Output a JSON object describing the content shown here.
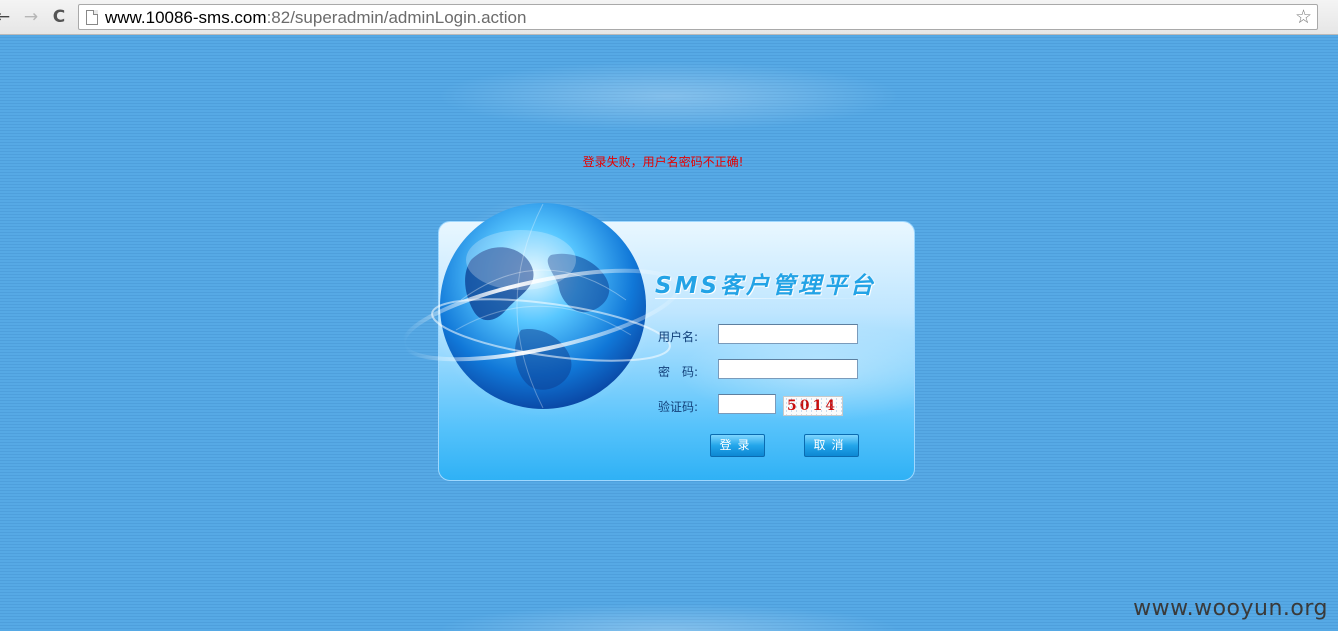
{
  "browser": {
    "url_host": "www.10086-sms.com",
    "url_path": ":82/superadmin/adminLogin.action",
    "back_glyph": "←",
    "forward_glyph": "→",
    "reload_glyph": "C",
    "star_glyph": "☆"
  },
  "page": {
    "error_message": "登录失败，用户名密码不正确!"
  },
  "login": {
    "title": "SMS客户管理平台",
    "username_label": "用户名:",
    "username_value": "",
    "password_label": "密　码:",
    "password_value": "",
    "captcha_label": "验证码:",
    "captcha_value": "",
    "captcha_image_text": "5014",
    "login_button": "登录",
    "cancel_button": "取消"
  },
  "watermark": "www.wooyun.org",
  "colors": {
    "background": "#52a6e3",
    "error": "#e60000",
    "title": "#23a3e6",
    "button": "#23a6ea"
  },
  "icons": [
    "back-arrow-icon",
    "forward-arrow-icon",
    "reload-icon",
    "page-icon",
    "bookmark-star-icon",
    "globe-icon"
  ]
}
